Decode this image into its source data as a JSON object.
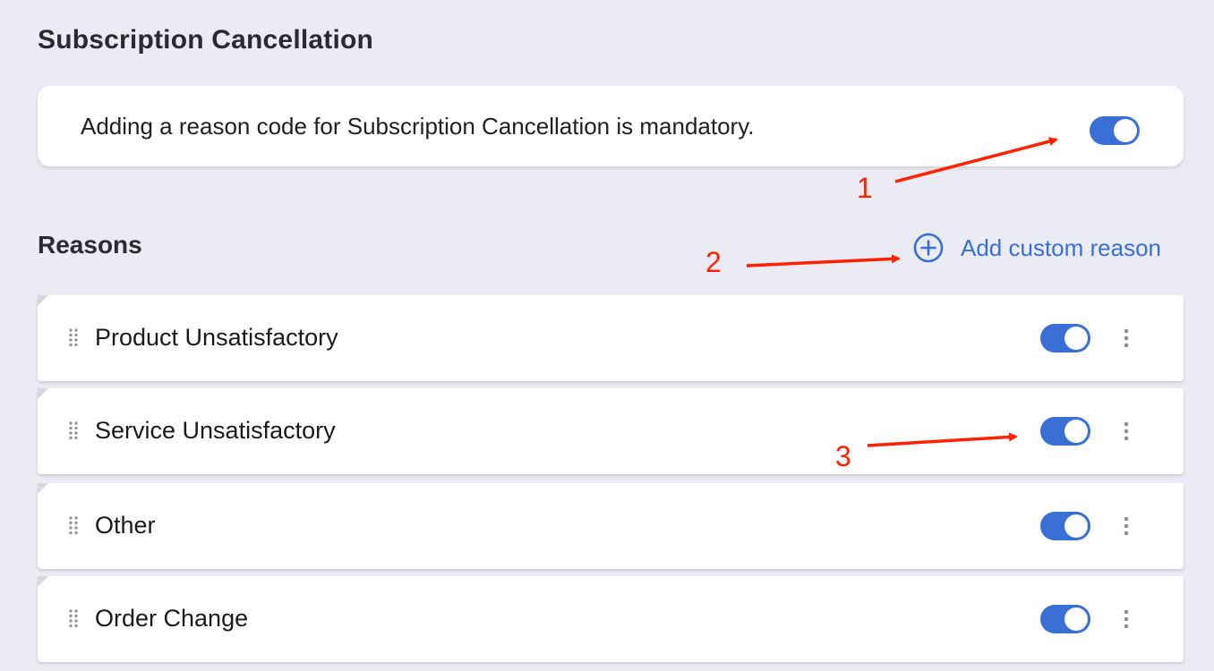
{
  "page": {
    "title": "Subscription Cancellation"
  },
  "mandatory": {
    "text": "Adding a reason code for Subscription Cancellation is mandatory.",
    "enabled": true
  },
  "reasons": {
    "title": "Reasons",
    "add_label": "Add custom reason",
    "items": [
      {
        "label": "Product Unsatisfactory",
        "enabled": true
      },
      {
        "label": "Service Unsatisfactory",
        "enabled": true
      },
      {
        "label": "Other",
        "enabled": true
      },
      {
        "label": "Order Change",
        "enabled": true
      }
    ]
  },
  "annotations": [
    "1",
    "2",
    "3"
  ],
  "colors": {
    "accent": "#3a6fd6",
    "annotation": "#ff2200",
    "background": "#ebebf3"
  },
  "icons": {
    "add": "plus-circle-icon",
    "drag": "drag-handle-icon",
    "more": "kebab-menu-icon"
  }
}
